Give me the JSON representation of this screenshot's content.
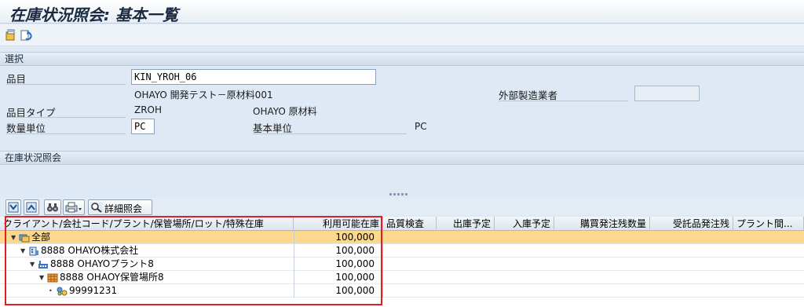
{
  "window": {
    "title": "在庫状況照会: 基本一覧"
  },
  "toolbar": {
    "icons": [
      "display-options-icon",
      "refresh-icon"
    ]
  },
  "selection": {
    "header": "選択",
    "material_label": "品目",
    "material_value": "KIN_YROH_06",
    "material_desc": "OHAYO 開発テスト－原材料001",
    "external_label": "外部製造業者",
    "external_value": "",
    "type_label": "品目タイプ",
    "type_code": "ZROH",
    "type_desc": "OHAYO 原材料",
    "unit_label": "数量単位",
    "unit_value": "PC",
    "base_unit_label": "基本単位",
    "base_unit_value": "PC"
  },
  "stock": {
    "header": "在庫状況照会",
    "buttons": {
      "detail_label": "詳細照会"
    },
    "columns": [
      "クライアント/会社コード/プラント/保管場所/ロット/特殊在庫",
      "利用可能在庫",
      "品質検査",
      "出庫予定",
      "入庫予定",
      "購買発注残数量",
      "受託品発注残",
      "プラント間..."
    ],
    "rows": [
      {
        "label": "全部",
        "value": "100,000",
        "level": 0,
        "icon": "stack-icon"
      },
      {
        "label": "8888 OHAYO株式会社",
        "value": "100,000",
        "level": 1,
        "icon": "company-icon"
      },
      {
        "label": "8888 OHAYOプラント8",
        "value": "100,000",
        "level": 2,
        "icon": "plant-icon"
      },
      {
        "label": "8888 OHAOY保管場所8",
        "value": "100,000",
        "level": 3,
        "icon": "storage-location-icon"
      },
      {
        "label": "99991231",
        "value": "100,000",
        "level": 4,
        "icon": "batch-icon"
      }
    ]
  },
  "colors": {
    "selected_row": "#fbd88d",
    "highlight_frame": "#e02020"
  }
}
